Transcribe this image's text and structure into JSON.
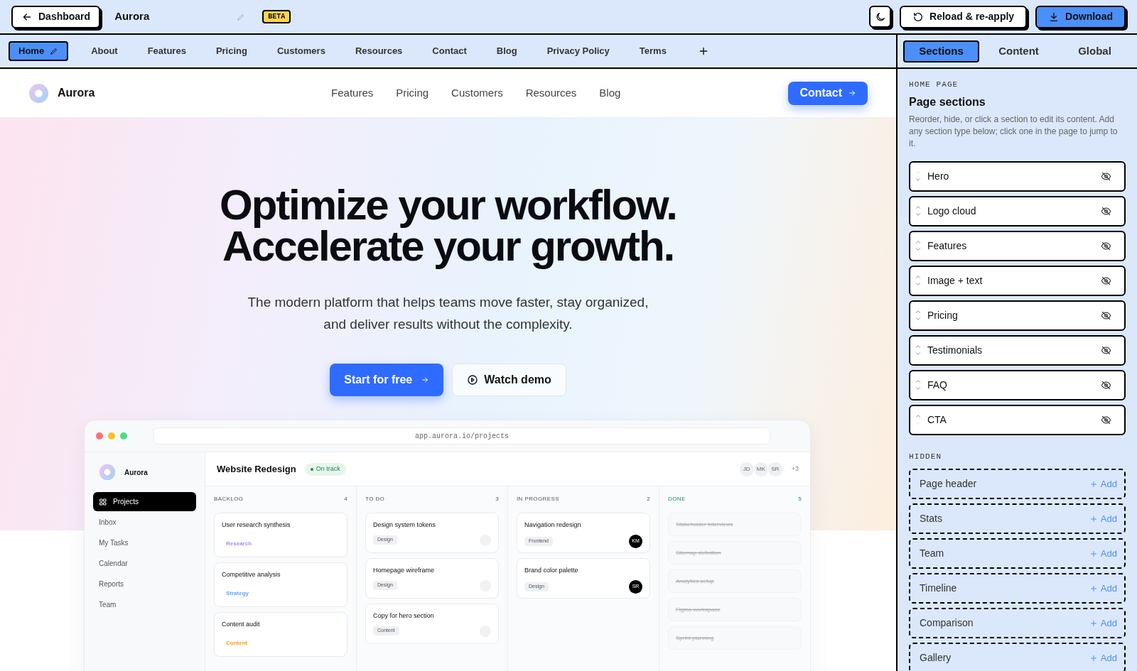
{
  "toolbar": {
    "back_button": "Dashboard",
    "site_name": "Aurora",
    "badge": "BETA",
    "actions": [
      {
        "label": "Reload & re-apply",
        "kind": "secondary"
      },
      {
        "label": "Download",
        "kind": "primary"
      }
    ]
  },
  "page_tabs": [
    {
      "label": "Home",
      "selected": true
    },
    {
      "label": "About",
      "selected": false
    },
    {
      "label": "Features",
      "selected": false
    },
    {
      "label": "Pricing",
      "selected": false
    },
    {
      "label": "Customers",
      "selected": false
    },
    {
      "label": "Resources",
      "selected": false
    },
    {
      "label": "Contact",
      "selected": false
    },
    {
      "label": "Blog",
      "selected": false
    },
    {
      "label": "Privacy Policy",
      "selected": false
    },
    {
      "label": "Terms",
      "selected": false
    }
  ],
  "site_header": {
    "brand": "Aurora",
    "nav": [
      "Features",
      "Pricing",
      "Customers",
      "Resources",
      "Blog"
    ],
    "cta": "Contact"
  },
  "hero": {
    "headline": [
      "Optimize your workflow.",
      "Accelerate your growth."
    ],
    "subtitle": [
      "The modern platform that helps teams move faster, stay organized,",
      "and deliver results without the complexity."
    ],
    "primary_button": "Start for free",
    "secondary_button": "Watch demo"
  },
  "app_preview": {
    "url": "app.aurora.io/projects",
    "brand": "Aurora",
    "nav": [
      {
        "label": "Projects",
        "selected": true
      },
      {
        "label": "Inbox",
        "selected": false
      },
      {
        "label": "My Tasks",
        "selected": false
      },
      {
        "label": "Calendar",
        "selected": false
      },
      {
        "label": "Reports",
        "selected": false
      },
      {
        "label": "Team",
        "selected": false
      }
    ],
    "project_title": "Website Redesign",
    "status": "On track",
    "avatars": [
      "JD",
      "MK",
      "SR"
    ],
    "more_members": "+3",
    "columns": [
      {
        "title": "BACKLOG",
        "count": "4",
        "kind": "open",
        "cards": [
          {
            "kind": "labeled",
            "title": "User research synthesis",
            "tag": "Research",
            "color": "#a78bfa"
          },
          {
            "kind": "labeled",
            "title": "Competitive analysis",
            "tag": "Strategy",
            "color": "#60a5fa"
          },
          {
            "kind": "labeled",
            "title": "Content audit",
            "tag": "Content",
            "color": "#f59e0b"
          }
        ]
      },
      {
        "title": "TO DO",
        "count": "3",
        "kind": "open",
        "cards": [
          {
            "kind": "pill",
            "title": "Design system tokens",
            "tag": "Design"
          },
          {
            "kind": "pill",
            "title": "Homepage wireframe",
            "tag": "Design"
          },
          {
            "kind": "pill",
            "title": "Copy for hero section",
            "tag": "Content"
          }
        ]
      },
      {
        "title": "IN PROGRESS",
        "count": "2",
        "kind": "open",
        "cards": [
          {
            "kind": "pill",
            "title": "Navigation redesign",
            "tag": "Frontend",
            "assignee": "KM"
          },
          {
            "kind": "pill",
            "title": "Brand color palette",
            "tag": "Design",
            "assignee": "SR"
          }
        ]
      },
      {
        "title": "DONE",
        "count": "5",
        "kind": "done",
        "cards": [
          {
            "kind": "done",
            "title": "Stakeholder interviews"
          },
          {
            "kind": "done",
            "title": "Sitemap definition"
          },
          {
            "kind": "done",
            "title": "Analytics setup"
          },
          {
            "kind": "done",
            "title": "Figma workspace"
          },
          {
            "kind": "done",
            "title": "Sprint planning"
          }
        ]
      }
    ]
  },
  "panel": {
    "tabs": [
      {
        "label": "Sections",
        "selected": true
      },
      {
        "label": "Content",
        "selected": false
      },
      {
        "label": "Global",
        "selected": false
      }
    ],
    "eyebrow": "HOME PAGE",
    "title": "Page sections",
    "description": "Reorder, hide, or click a section to edit its content. Add any section type below; click one in the page to jump to it.",
    "sections": [
      {
        "label": "Hero",
        "can_move_up": false,
        "can_move_down": true
      },
      {
        "label": "Logo cloud",
        "can_move_up": true,
        "can_move_down": true
      },
      {
        "label": "Features",
        "can_move_up": true,
        "can_move_down": true
      },
      {
        "label": "Image + text",
        "can_move_up": true,
        "can_move_down": true
      },
      {
        "label": "Pricing",
        "can_move_up": true,
        "can_move_down": true
      },
      {
        "label": "Testimonials",
        "can_move_up": true,
        "can_move_down": true
      },
      {
        "label": "FAQ",
        "can_move_up": true,
        "can_move_down": true
      },
      {
        "label": "CTA",
        "can_move_up": true,
        "can_move_down": false
      }
    ],
    "hidden_label": "HIDDEN",
    "hidden_sections": [
      {
        "label": "Page header",
        "action": "Add"
      },
      {
        "label": "Stats",
        "action": "Add"
      },
      {
        "label": "Team",
        "action": "Add"
      },
      {
        "label": "Timeline",
        "action": "Add"
      },
      {
        "label": "Comparison",
        "action": "Add"
      },
      {
        "label": "Gallery",
        "action": "Add"
      }
    ]
  }
}
